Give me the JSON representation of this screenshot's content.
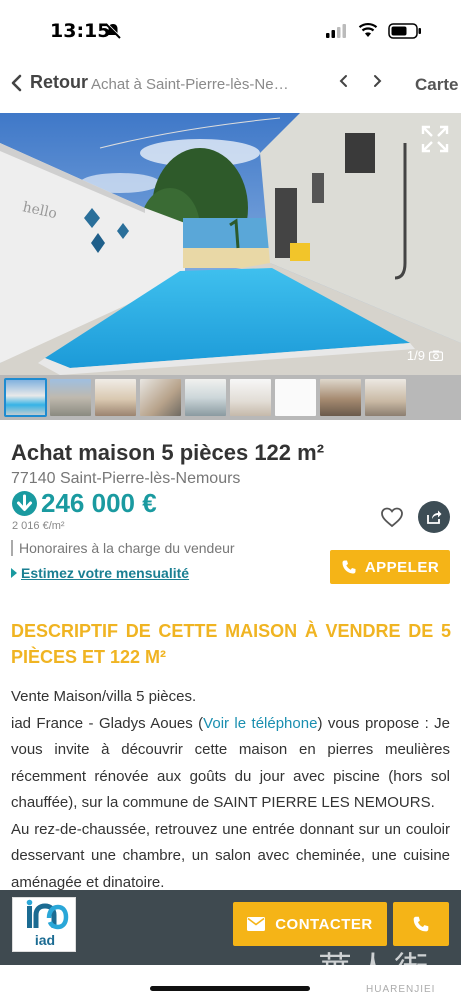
{
  "status_bar": {
    "time": "13:15"
  },
  "nav": {
    "back_label": "Retour",
    "breadcrumb": "Achat à Saint-Pierre-lès-Nem...",
    "map_label": "Carte"
  },
  "gallery": {
    "counter": "1/9",
    "thumb_count": 9
  },
  "listing": {
    "title": "Achat maison 5 pièces 122 m²",
    "location": "77140 Saint-Pierre-lès-Nemours",
    "price": "246 000 €",
    "price_per_sqm": "2 016 €/m²",
    "fees": "Honoraires à la charge du vendeur",
    "estimate_link": "Estimez votre mensualité",
    "call_label": "APPELER"
  },
  "description": {
    "heading": "DESCRIPTIF DE CETTE MAISON À VENDRE DE 5 PIÈCES ET 122 M²",
    "line1": "Vente Maison/villa 5 pièces.",
    "p2_before": "iad France - Gladys Aoues (",
    "p2_link": "Voir le téléphone",
    "p2_after": ") vous propose : Je vous invite à découvrir cette maison en pierres meulières récemment rénovée aux goûts du jour avec piscine (hors sol chauffée), sur la commune de SAINT PIERRE LES NEMOURS.",
    "p3": "Au rez-de-chaussée, retrouvez une entrée donnant sur un couloir desservant une chambre, un salon avec cheminée, une cuisine aménagée et dinatoire."
  },
  "bottom_bar": {
    "logo_text": "iad",
    "contact_label": "CONTACTER"
  },
  "watermark": {
    "main": "華人街",
    "sub": "HUARENJIEI"
  },
  "colors": {
    "accent_yellow": "#f5b417",
    "price_teal": "#1a9aa0",
    "bar_dark": "#3f4a50"
  }
}
